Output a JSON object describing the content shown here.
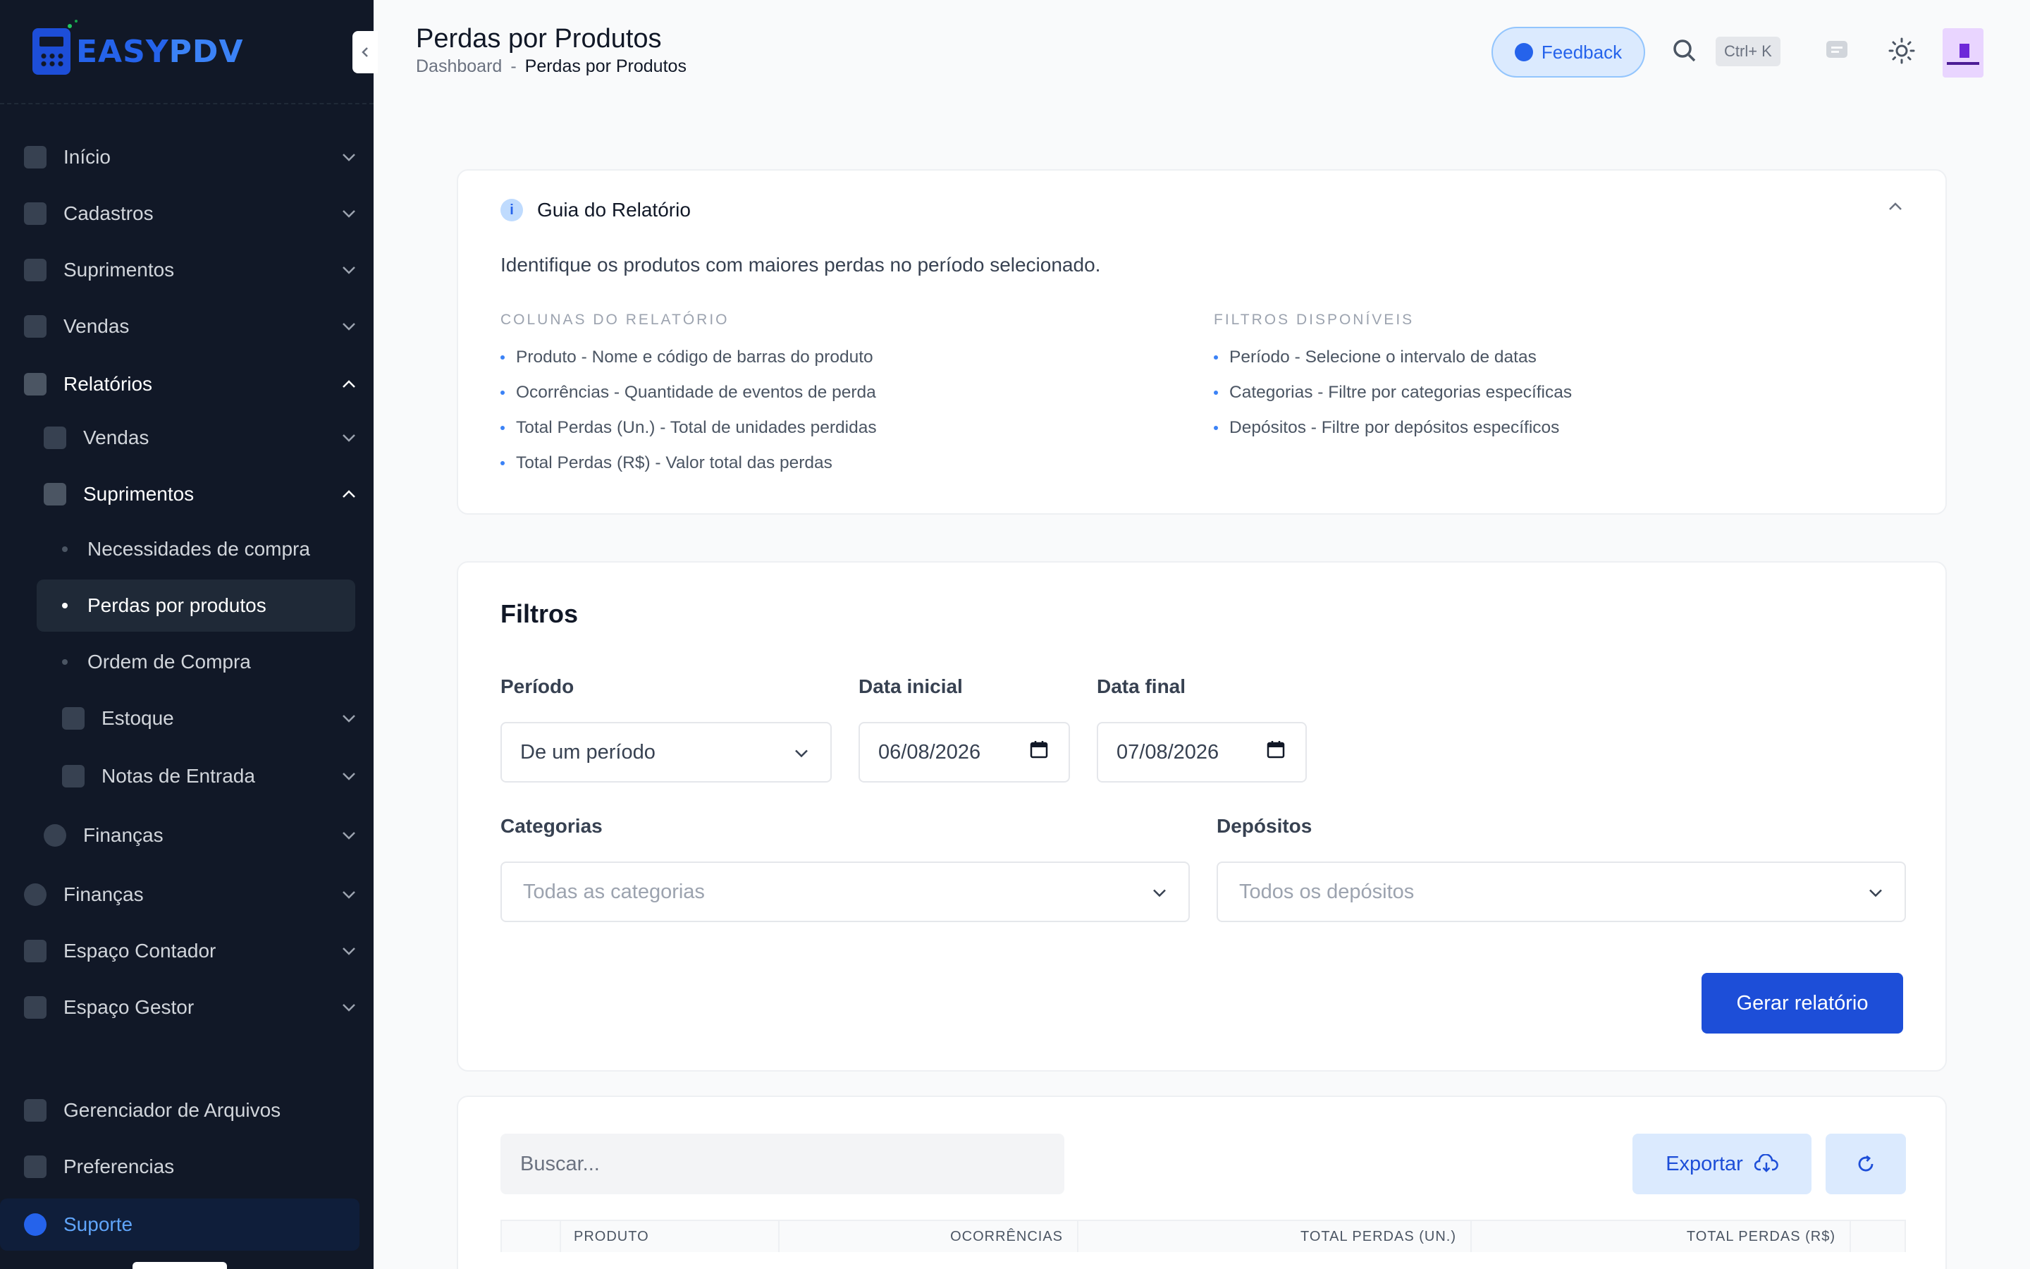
{
  "brand": {
    "part1": "EASY",
    "part2": "PDV"
  },
  "sidebar": {
    "items": [
      {
        "label": "Início",
        "icon": "grid-icon"
      },
      {
        "label": "Cadastros",
        "icon": "id-card-icon"
      },
      {
        "label": "Suprimentos",
        "icon": "box-icon"
      },
      {
        "label": "Vendas",
        "icon": "register-icon"
      },
      {
        "label": "Relatórios",
        "icon": "chart-line-icon"
      }
    ],
    "reports": {
      "vendas": "Vendas",
      "suprimentos": "Suprimentos",
      "leaf1": "Necessidades de compra",
      "leaf2": "Perdas por produtos",
      "leaf3": "Ordem de Compra",
      "estoque": "Estoque",
      "notas": "Notas de Entrada",
      "financas": "Finanças"
    },
    "bottom": [
      {
        "label": "Finanças",
        "icon": "dollar-icon"
      },
      {
        "label": "Espaço Contador",
        "icon": "calculator-icon"
      },
      {
        "label": "Espaço Gestor",
        "icon": "users-icon"
      }
    ],
    "footer": {
      "files": "Gerenciador de Arquivos",
      "prefs": "Preferencias",
      "support": "Suporte"
    }
  },
  "header": {
    "title": "Perdas por Produtos",
    "breadcrumb": {
      "home": "Dashboard",
      "sep": "-",
      "current": "Perdas por Produtos"
    },
    "feedback_label": "Feedback",
    "shortcut": "Ctrl+ K"
  },
  "guide": {
    "title": "Guia do Relatório",
    "description": "Identifique os produtos com maiores perdas no período selecionado.",
    "columns_heading": "COLUNAS DO RELATÓRIO",
    "columns": [
      "Produto - Nome e código de barras do produto",
      "Ocorrências - Quantidade de eventos de perda",
      "Total Perdas (Un.) - Total de unidades perdidas",
      "Total Perdas (R$) - Valor total das perdas"
    ],
    "filters_heading": "FILTROS DISPONÍVEIS",
    "filters": [
      "Período - Selecione o intervalo de datas",
      "Categorias - Filtre por categorias específicas",
      "Depósitos - Filtre por depósitos específicos"
    ]
  },
  "filters": {
    "title": "Filtros",
    "period_label": "Período",
    "period_value": "De um período",
    "start_label": "Data inicial",
    "start_value": "06/08/2026",
    "end_label": "Data final",
    "end_value": "07/08/2026",
    "categories_label": "Categorias",
    "categories_placeholder": "Todas as categorias",
    "deposits_label": "Depósitos",
    "deposits_placeholder": "Todos os depósitos",
    "submit_label": "Gerar relatório"
  },
  "results": {
    "search_placeholder": "Buscar...",
    "export_label": "Exportar",
    "columns": [
      "PRODUTO",
      "OCORRÊNCIAS",
      "TOTAL PERDAS (UN.)",
      "TOTAL PERDAS (R$)"
    ]
  },
  "colors": {
    "sidebar_bg": "#111827",
    "primary": "#1d4ed8",
    "accent_soft": "#dbeafe"
  }
}
